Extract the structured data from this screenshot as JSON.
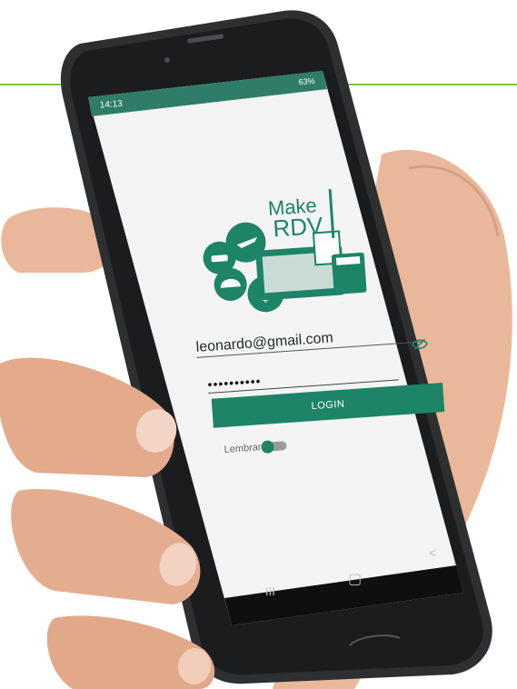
{
  "status_bar": {
    "time": "14:13",
    "right": "63%"
  },
  "logo": {
    "line1": "Make",
    "line2": "RDV"
  },
  "form": {
    "email_value": "leonardo@gmail.com",
    "password_value": "••••••••••",
    "login_label": "LOGIN",
    "remember_label": "Lembrar",
    "remember_on": true
  },
  "nav_bar": {
    "recent": "III",
    "home": "▢",
    "back": "<"
  },
  "colors": {
    "accent": "#1d8467",
    "line": "#7cc04e"
  },
  "icons": [
    "eye-off-icon",
    "airplane-icon",
    "car-icon",
    "cloche-icon",
    "dollar-icon",
    "calculator-icon",
    "receipt-icon",
    "monitor-icon"
  ]
}
